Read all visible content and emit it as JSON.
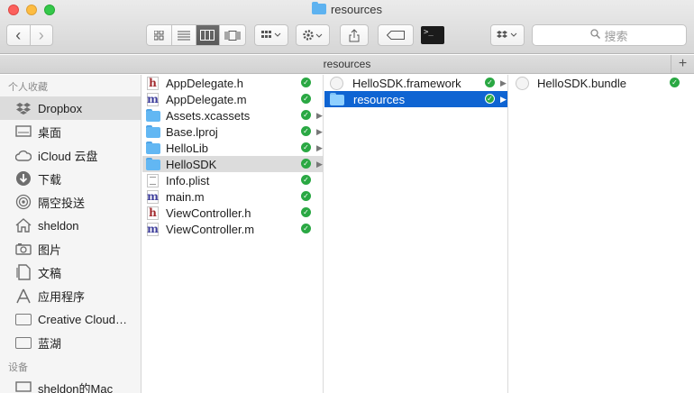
{
  "window": {
    "title": "resources"
  },
  "toolbar": {
    "back": "‹",
    "forward": "›",
    "search_placeholder": "搜索"
  },
  "pathbar": {
    "label": "resources",
    "plus": "+"
  },
  "sidebar": {
    "favorites_header": "个人收藏",
    "devices_header": "设备",
    "items": [
      {
        "label": "Dropbox",
        "icon": "dropbox-icon"
      },
      {
        "label": "桌面",
        "icon": "desktop-icon"
      },
      {
        "label": "iCloud 云盘",
        "icon": "cloud-icon"
      },
      {
        "label": "下载",
        "icon": "download-icon"
      },
      {
        "label": "隔空投送",
        "icon": "airdrop-icon"
      },
      {
        "label": "sheldon",
        "icon": "home-icon"
      },
      {
        "label": "图片",
        "icon": "camera-icon"
      },
      {
        "label": "文稿",
        "icon": "document-icon"
      },
      {
        "label": "应用程序",
        "icon": "applications-icon"
      },
      {
        "label": "Creative Cloud…",
        "icon": "folder-icon"
      },
      {
        "label": "蓝湖",
        "icon": "folder-icon"
      }
    ],
    "device": {
      "label": "sheldon的Mac",
      "icon": "computer-icon"
    }
  },
  "columns": {
    "col1": [
      {
        "name": "AppDelegate.h",
        "type": "h"
      },
      {
        "name": "AppDelegate.m",
        "type": "m"
      },
      {
        "name": "Assets.xcassets",
        "type": "folder",
        "arrow": true
      },
      {
        "name": "Base.lproj",
        "type": "folder",
        "arrow": true
      },
      {
        "name": "HelloLib",
        "type": "folder",
        "arrow": true
      },
      {
        "name": "HelloSDK",
        "type": "folder",
        "arrow": true
      },
      {
        "name": "Info.plist",
        "type": "plist"
      },
      {
        "name": "main.m",
        "type": "m"
      },
      {
        "name": "ViewController.h",
        "type": "h"
      },
      {
        "name": "ViewController.m",
        "type": "m"
      }
    ],
    "col2": [
      {
        "name": "HelloSDK.framework",
        "type": "pkg",
        "arrow": true
      },
      {
        "name": "resources",
        "type": "folder",
        "arrow": true
      }
    ],
    "col3": [
      {
        "name": "HelloSDK.bundle",
        "type": "pkg"
      }
    ]
  },
  "glyphs": {
    "check": "✓",
    "arrow": "▶",
    "h": "h",
    "m": "m"
  }
}
